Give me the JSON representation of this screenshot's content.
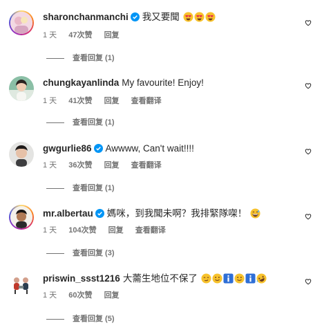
{
  "comments": [
    {
      "username": "sharonchanmanchi",
      "verified": true,
      "text": "我又要聞",
      "emojis": [
        "heart-eyes-emoji",
        "heart-eyes-emoji",
        "heart-eyes-emoji"
      ],
      "time": "1 天",
      "likes": "47次赞",
      "reply_label": "回复",
      "translate_label": "",
      "view_replies": "查看回复 (1)"
    },
    {
      "username": "chungkayanlinda",
      "verified": false,
      "text": "My favourite! Enjoy!",
      "emojis": [],
      "time": "1 天",
      "likes": "41次赞",
      "reply_label": "回复",
      "translate_label": "查看翻译",
      "view_replies": "查看回复 (1)"
    },
    {
      "username": "gwgurlie86",
      "verified": true,
      "text": "Awwww, Can't wait!!!!",
      "emojis": [],
      "time": "1 天",
      "likes": "36次赞",
      "reply_label": "回复",
      "translate_label": "查看翻译",
      "view_replies": "查看回复 (1)"
    },
    {
      "username": "mr.albertau",
      "verified": true,
      "text": "媽咪，到我聞未啊？我排緊隊㗎！",
      "emojis": [
        "grinning-sweat-emoji"
      ],
      "time": "1 天",
      "likes": "104次赞",
      "reply_label": "回复",
      "translate_label": "查看翻译",
      "view_replies": "查看回复 (3)"
    },
    {
      "username": "priswin_ssst1216",
      "verified": false,
      "text": "大薷生地位不保了",
      "emojis": [
        "smirk-emoji",
        "slight-smile-emoji",
        "info-emoji",
        "slight-smile-emoji",
        "info-emoji",
        "rofl-emoji"
      ],
      "time": "1 天",
      "likes": "60次赞",
      "reply_label": "回复",
      "translate_label": "",
      "view_replies": "查看回复 (5)"
    }
  ],
  "colors": {
    "text": "#262626",
    "secondary": "#737373",
    "verified": "#0095f6"
  }
}
